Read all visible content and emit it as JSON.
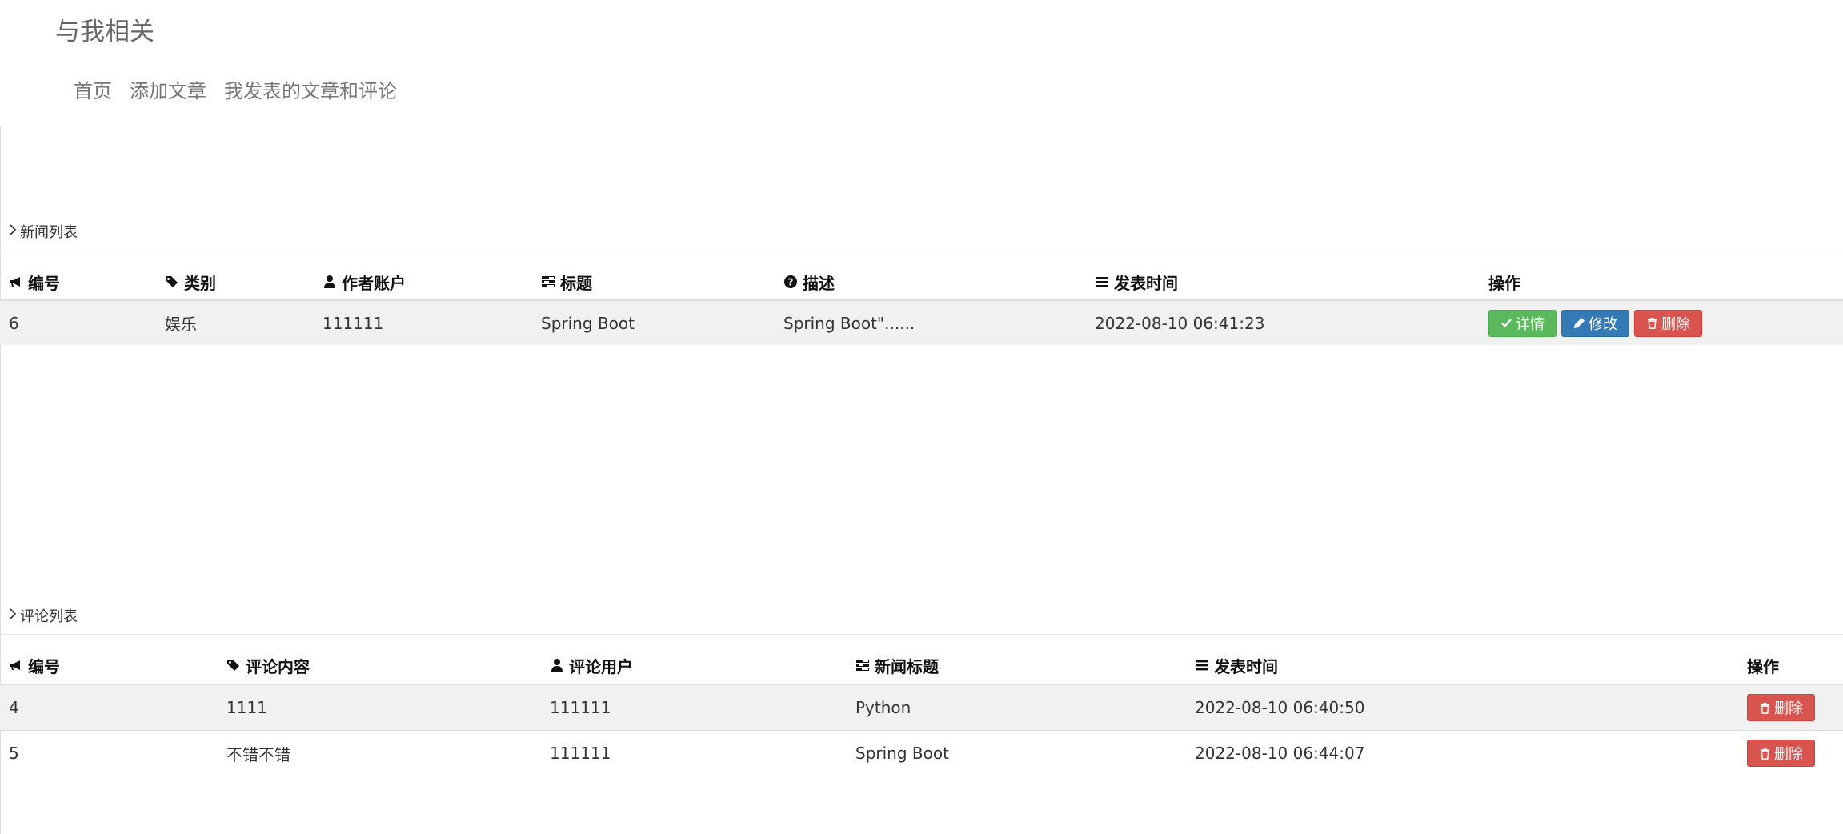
{
  "header": {
    "brand": "与我相关",
    "nav": [
      "首页",
      "添加文章",
      "我发表的文章和评论"
    ]
  },
  "news_section": {
    "title": "新闻列表",
    "columns": {
      "id": "编号",
      "category": "类别",
      "author": "作者账户",
      "title": "标题",
      "description": "描述",
      "time": "发表时间",
      "actions": "操作"
    },
    "rows": [
      {
        "id": "6",
        "category": "娱乐",
        "author": "111111",
        "title": "Spring Boot",
        "description": "Spring Boot\"......",
        "time": "2022-08-10 06:41:23",
        "detail_label": "详情",
        "edit_label": "修改",
        "delete_label": "删除"
      }
    ]
  },
  "comments_section": {
    "title": "评论列表",
    "columns": {
      "id": "编号",
      "content": "评论内容",
      "user": "评论用户",
      "news_title": "新闻标题",
      "time": "发表时间",
      "actions": "操作"
    },
    "rows": [
      {
        "id": "4",
        "content": "1111",
        "user": "111111",
        "news_title": "Python",
        "time": "2022-08-10 06:40:50",
        "delete_label": "删除"
      },
      {
        "id": "5",
        "content": "不错不错",
        "user": "111111",
        "news_title": "Spring Boot",
        "time": "2022-08-10 06:44:07",
        "delete_label": "删除"
      }
    ]
  },
  "icons": {
    "id": "bullhorn-icon",
    "category": "tags-icon",
    "user": "user-icon",
    "title": "tasks-icon",
    "description": "question-circle-icon",
    "time": "list-icon",
    "detail": "check-icon",
    "edit": "pencil-icon",
    "delete": "trash-icon",
    "section": "chevron-right-icon"
  },
  "colors": {
    "success": "#5cb85c",
    "primary": "#337ab7",
    "danger": "#d9534f",
    "stripe": "#f1f1f1"
  }
}
